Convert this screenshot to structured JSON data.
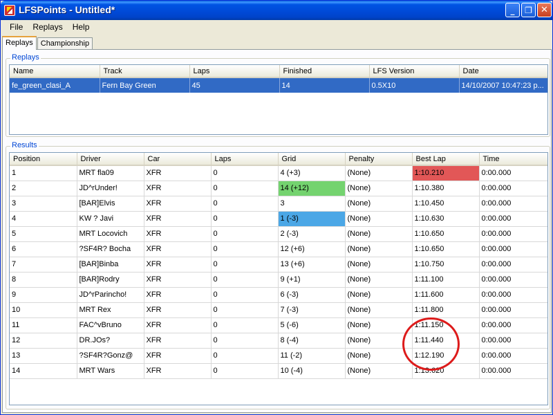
{
  "window": {
    "title": "LFSPoints - Untitled*",
    "icons": {
      "app": "app-icon",
      "minimize": "minimize-icon",
      "maximize": "restore-icon",
      "close": "close-icon"
    },
    "controls": {
      "minimize": "_",
      "maximize": "❐",
      "close": "✕"
    }
  },
  "menu": {
    "file": "File",
    "replays": "Replays",
    "help": "Help"
  },
  "tabs": {
    "replays": "Replays",
    "championship": "Championship"
  },
  "replays": {
    "label": "Replays",
    "columns": [
      "Name",
      "Track",
      "Laps",
      "Finished",
      "LFS Version",
      "Date"
    ],
    "rows": [
      {
        "name": "fe_green_clasi_A",
        "track": "Fern Bay Green",
        "laps": "45",
        "finished": "14",
        "version": "0.5X10",
        "date": "14/10/2007 10:47:23 p..."
      }
    ]
  },
  "results": {
    "label": "Results",
    "columns": [
      "Position",
      "Driver",
      "Car",
      "Laps",
      "Grid",
      "Penalty",
      "Best Lap",
      "Time"
    ],
    "rows": [
      {
        "position": "1",
        "driver": "MRT fla09",
        "car": "XFR",
        "laps": "0",
        "grid": "4 (+3)",
        "penalty": "(None)",
        "best_lap": "1:10.210",
        "time": "0:00.000"
      },
      {
        "position": "2",
        "driver": "JD^rUnder!",
        "car": "XFR",
        "laps": "0",
        "grid": "14 (+12)",
        "penalty": "(None)",
        "best_lap": "1:10.380",
        "time": "0:00.000"
      },
      {
        "position": "3",
        "driver": "[BAR]Elvis",
        "car": "XFR",
        "laps": "0",
        "grid": "3",
        "penalty": "(None)",
        "best_lap": "1:10.450",
        "time": "0:00.000"
      },
      {
        "position": "4",
        "driver": "KW ? Javi",
        "car": "XFR",
        "laps": "0",
        "grid": "1 (-3)",
        "penalty": "(None)",
        "best_lap": "1:10.630",
        "time": "0:00.000"
      },
      {
        "position": "5",
        "driver": "MRT Locovich",
        "car": "XFR",
        "laps": "0",
        "grid": "2 (-3)",
        "penalty": "(None)",
        "best_lap": "1:10.650",
        "time": "0:00.000"
      },
      {
        "position": "6",
        "driver": "?SF4R? Bocha",
        "car": "XFR",
        "laps": "0",
        "grid": "12 (+6)",
        "penalty": "(None)",
        "best_lap": "1:10.650",
        "time": "0:00.000"
      },
      {
        "position": "7",
        "driver": "[BAR]Binba",
        "car": "XFR",
        "laps": "0",
        "grid": "13 (+6)",
        "penalty": "(None)",
        "best_lap": "1:10.750",
        "time": "0:00.000"
      },
      {
        "position": "8",
        "driver": "[BAR]Rodry",
        "car": "XFR",
        "laps": "0",
        "grid": "9 (+1)",
        "penalty": "(None)",
        "best_lap": "1:11.100",
        "time": "0:00.000"
      },
      {
        "position": "9",
        "driver": "JD^rParincho!",
        "car": "XFR",
        "laps": "0",
        "grid": "6 (-3)",
        "penalty": "(None)",
        "best_lap": "1:11.600",
        "time": "0:00.000"
      },
      {
        "position": "10",
        "driver": "MRT Rex",
        "car": "XFR",
        "laps": "0",
        "grid": "7 (-3)",
        "penalty": "(None)",
        "best_lap": "1:11.800",
        "time": "0:00.000"
      },
      {
        "position": "11",
        "driver": "FAC^vBruno",
        "car": "XFR",
        "laps": "0",
        "grid": "5 (-6)",
        "penalty": "(None)",
        "best_lap": "1:11.150",
        "time": "0:00.000"
      },
      {
        "position": "12",
        "driver": "DR.JOs?",
        "car": "XFR",
        "laps": "0",
        "grid": "8 (-4)",
        "penalty": "(None)",
        "best_lap": "1:11.440",
        "time": "0:00.000"
      },
      {
        "position": "13",
        "driver": "?SF4R?Gonz@",
        "car": "XFR",
        "laps": "0",
        "grid": "11 (-2)",
        "penalty": "(None)",
        "best_lap": "1:12.190",
        "time": "0:00.000"
      },
      {
        "position": "14",
        "driver": "MRT Wars",
        "car": "XFR",
        "laps": "0",
        "grid": "10 (-4)",
        "penalty": "(None)",
        "best_lap": "1:13.620",
        "time": "0:00.000"
      }
    ]
  },
  "colors": {
    "selection": "#316ac5",
    "best_lap_highlight": "#e25757",
    "grid_gain_highlight": "#74d36f",
    "grid_pole_highlight": "#4ba7e6",
    "annotation_circle": "#dd1b1b"
  }
}
